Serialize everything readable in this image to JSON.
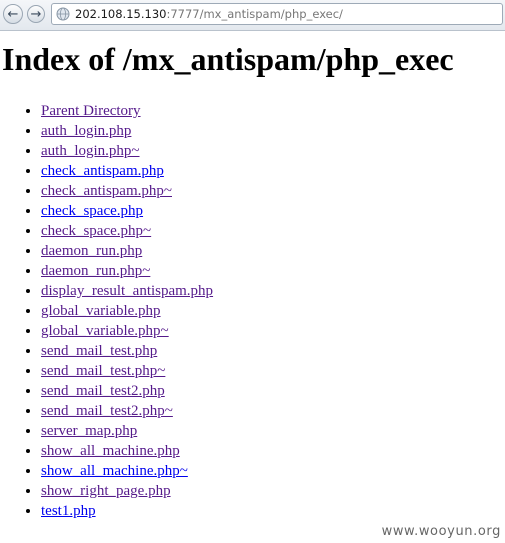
{
  "browser": {
    "back_icon": "back-arrow-icon",
    "forward_icon": "forward-arrow-icon",
    "page_icon": "globe-icon",
    "address": {
      "host": "202.108.15.130",
      "path": ":7777/mx_antispam/php_exec/"
    }
  },
  "page": {
    "title": "Index of /mx_antispam/php_exec",
    "entries": [
      {
        "label": "Parent Directory",
        "visited": true
      },
      {
        "label": "auth_login.php",
        "visited": true
      },
      {
        "label": "auth_login.php~",
        "visited": true
      },
      {
        "label": "check_antispam.php",
        "visited": false
      },
      {
        "label": "check_antispam.php~",
        "visited": true
      },
      {
        "label": "check_space.php",
        "visited": false
      },
      {
        "label": "check_space.php~",
        "visited": true
      },
      {
        "label": "daemon_run.php",
        "visited": true
      },
      {
        "label": "daemon_run.php~",
        "visited": true
      },
      {
        "label": "display_result_antispam.php",
        "visited": true
      },
      {
        "label": "global_variable.php",
        "visited": true
      },
      {
        "label": "global_variable.php~",
        "visited": true
      },
      {
        "label": "send_mail_test.php",
        "visited": true
      },
      {
        "label": "send_mail_test.php~",
        "visited": true
      },
      {
        "label": "send_mail_test2.php",
        "visited": true
      },
      {
        "label": "send_mail_test2.php~",
        "visited": true
      },
      {
        "label": "server_map.php",
        "visited": true
      },
      {
        "label": "show_all_machine.php",
        "visited": true
      },
      {
        "label": "show_all_machine.php~",
        "visited": false
      },
      {
        "label": "show_right_page.php",
        "visited": true
      },
      {
        "label": "test1.php",
        "visited": false
      }
    ]
  },
  "watermark": "www.wooyun.org"
}
